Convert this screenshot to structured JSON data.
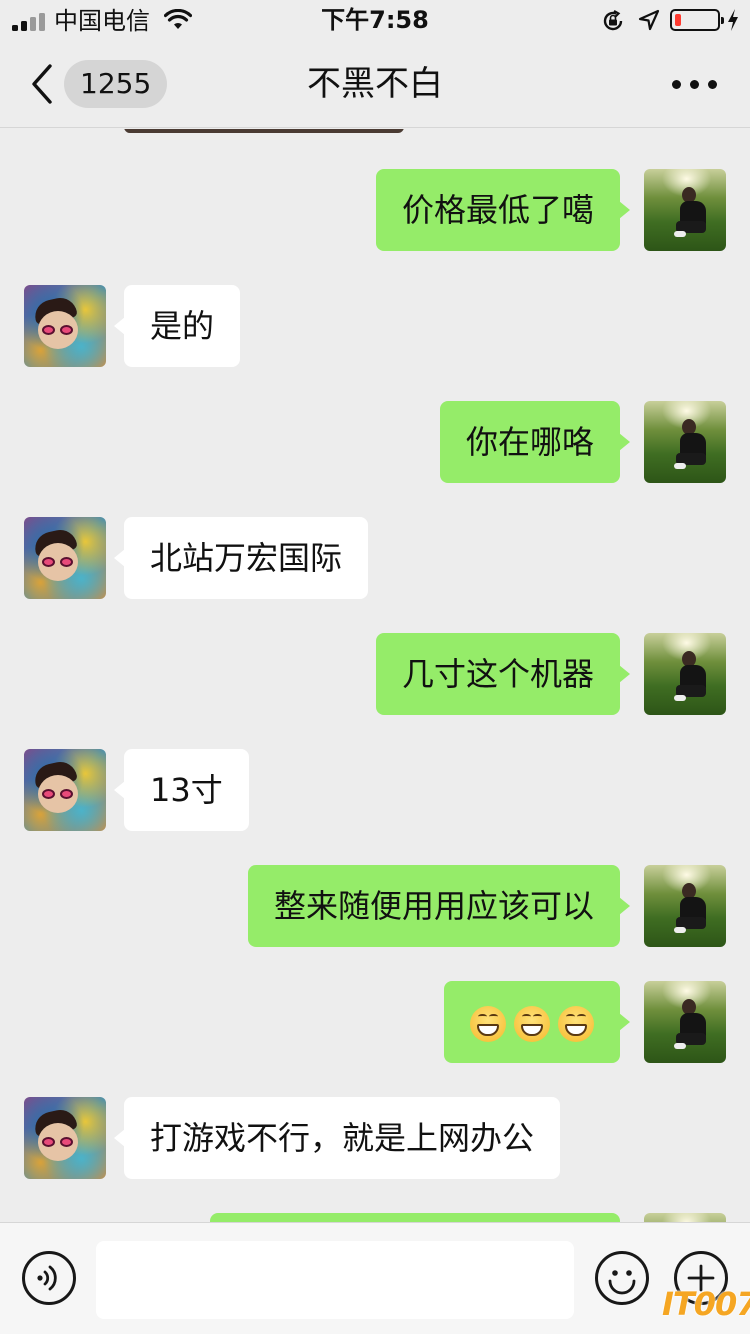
{
  "status_bar": {
    "carrier": "中国电信",
    "time": "下午7:58",
    "battery_level": 0.15
  },
  "nav": {
    "unread_count": "1255",
    "title": "不黑不白"
  },
  "messages": [
    {
      "sender": "me",
      "text": "价格最低了噶"
    },
    {
      "sender": "other",
      "text": "是的"
    },
    {
      "sender": "me",
      "text": "你在哪咯"
    },
    {
      "sender": "other",
      "text": "北站万宏国际"
    },
    {
      "sender": "me",
      "text": "几寸这个机器"
    },
    {
      "sender": "other",
      "text": "13寸"
    },
    {
      "sender": "me",
      "text": "整来随便用用应该可以"
    },
    {
      "sender": "me",
      "emoji": [
        "grinning-face",
        "grinning-face",
        "grinning-face"
      ]
    },
    {
      "sender": "other",
      "text": "打游戏不行，就是上网办公"
    }
  ],
  "input": {
    "value": "",
    "placeholder": ""
  },
  "watermark": "IT007",
  "colors": {
    "background": "#ededed",
    "my_bubble": "#95ec69",
    "other_bubble": "#ffffff",
    "battery_low": "#ff3b30"
  }
}
